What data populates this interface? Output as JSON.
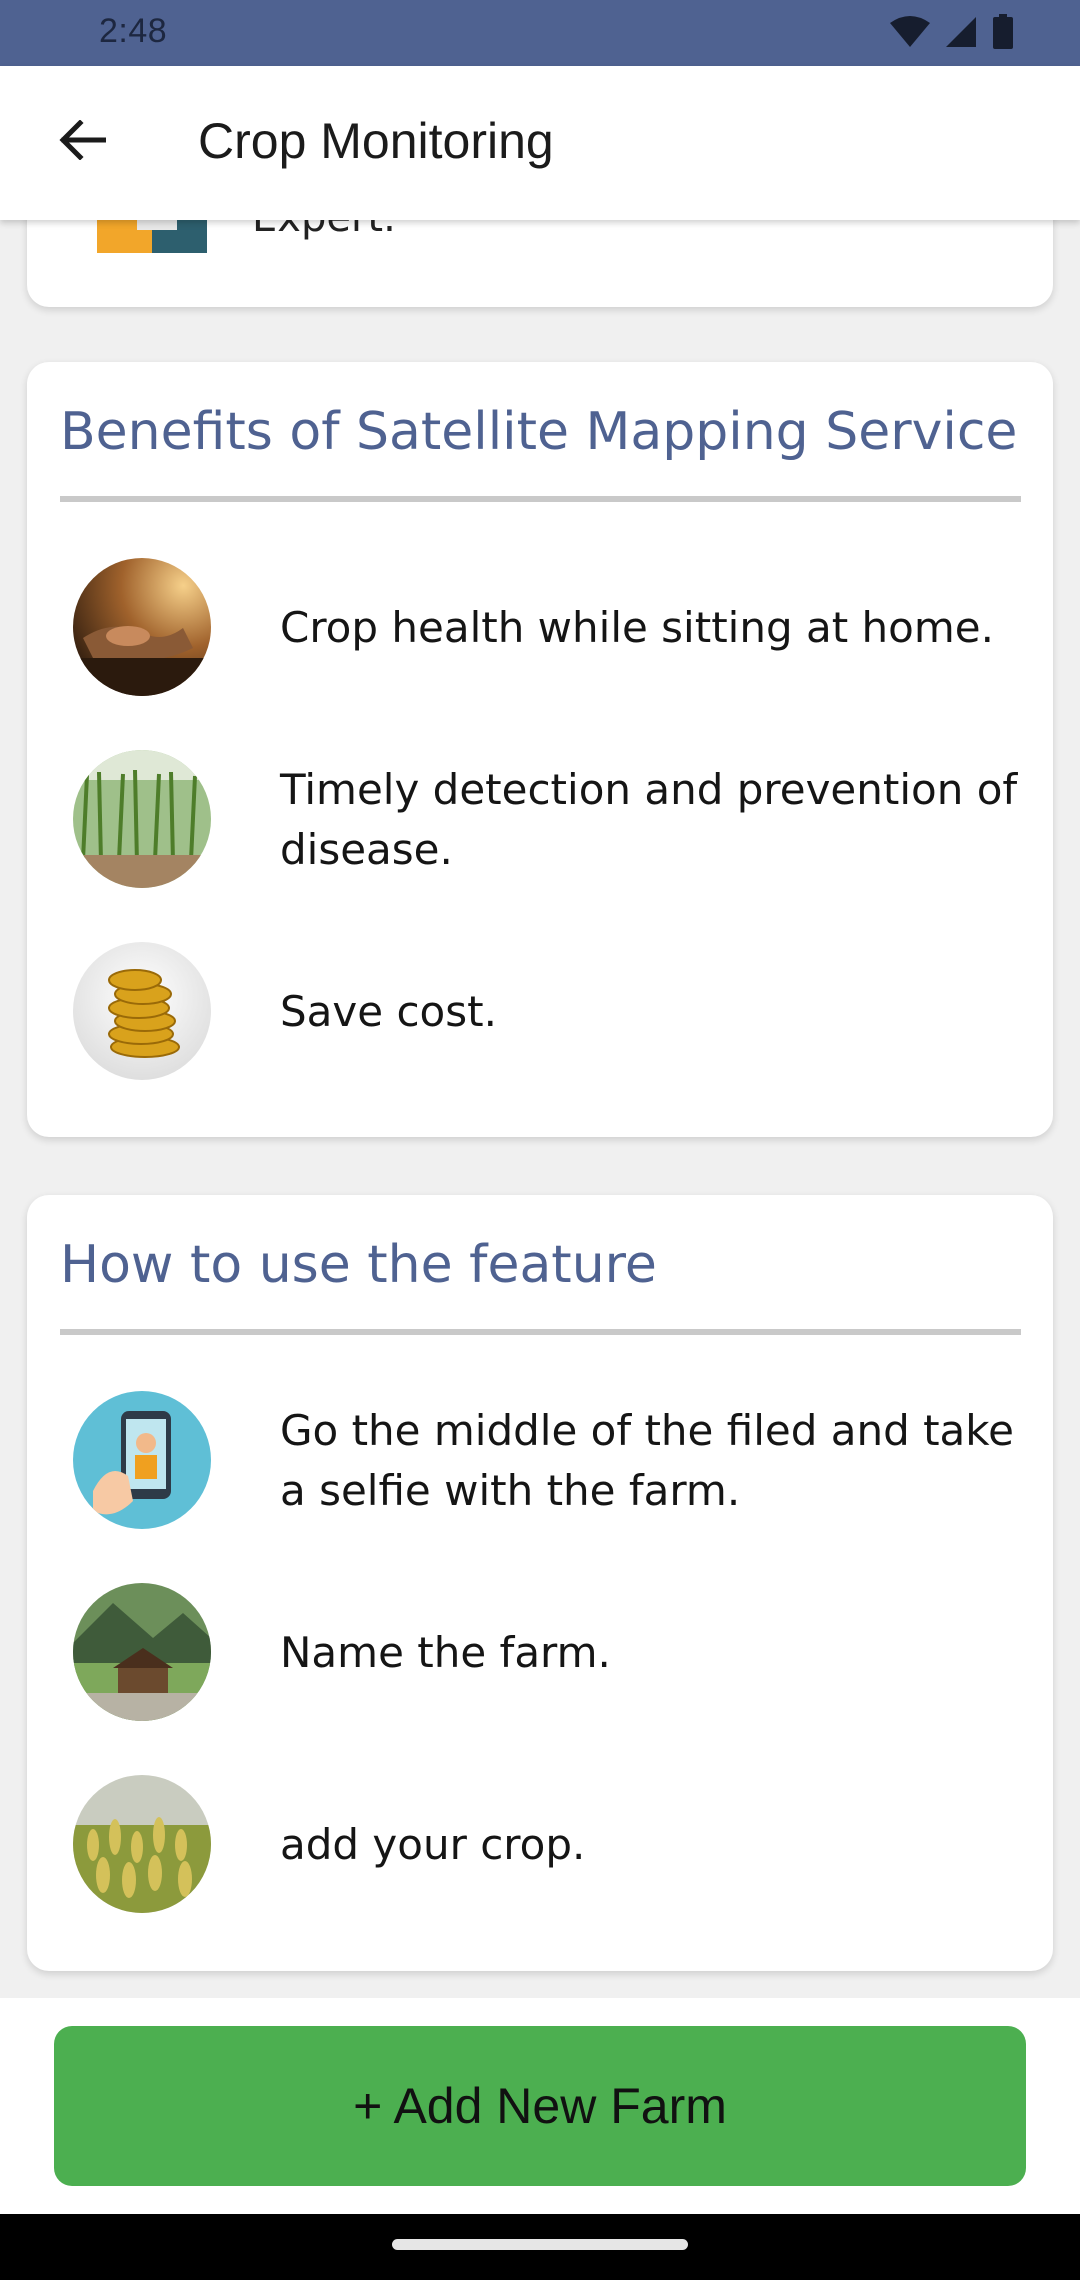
{
  "status_bar": {
    "time": "2:48",
    "icons": [
      "wifi-icon",
      "signal-icon",
      "battery-icon"
    ]
  },
  "app_bar": {
    "back_icon": "arrow-left-icon",
    "title": "Crop Monitoring"
  },
  "partial_card": {
    "text": "Expert."
  },
  "benefits": {
    "title": "Benefits of Satellite Mapping Service",
    "items": [
      {
        "icon": "hands-soil-photo",
        "text": "Crop health while sitting at home."
      },
      {
        "icon": "cornfield-photo",
        "text": "Timely detection and prevention of disease."
      },
      {
        "icon": "gold-coins-photo",
        "text": "Save cost."
      }
    ]
  },
  "how_to": {
    "title": "How to use the feature",
    "items": [
      {
        "icon": "selfie-phone-illustration",
        "text": "Go the middle of the filed and take a selfie with the farm."
      },
      {
        "icon": "farmhouse-photo",
        "text": "Name the farm."
      },
      {
        "icon": "wheat-photo",
        "text": "add your crop."
      }
    ]
  },
  "footer": {
    "add_button_label": "+ Add New Farm"
  },
  "colors": {
    "status_bar": "#4f6291",
    "card_title": "#4f6291",
    "primary_button": "#4caf50",
    "divider": "#c9c9c9"
  }
}
